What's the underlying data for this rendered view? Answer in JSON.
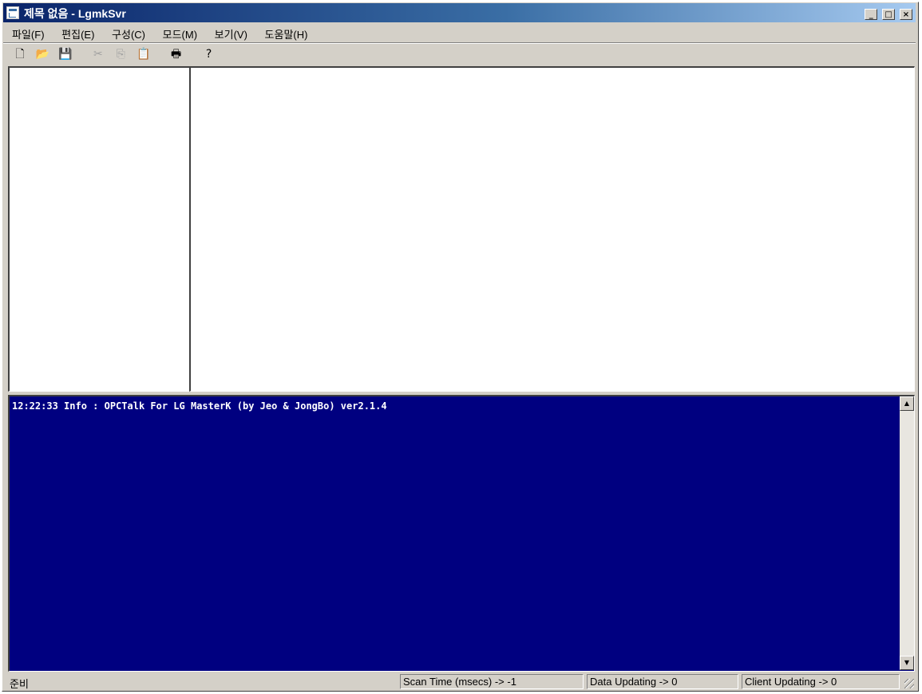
{
  "window": {
    "title": "제목 없음 - LgmkSvr",
    "controls": {
      "minimize": "_",
      "maximize": "□",
      "close": "×"
    }
  },
  "menu": [
    {
      "label": "파일(F)"
    },
    {
      "label": "편집(E)"
    },
    {
      "label": "구성(C)"
    },
    {
      "label": "모드(M)"
    },
    {
      "label": "보기(V)"
    },
    {
      "label": "도움말(H)"
    }
  ],
  "toolbar": {
    "buttons": [
      {
        "name": "new-file-icon",
        "glyph": "🗋",
        "enabled": true
      },
      {
        "name": "open-folder-icon",
        "glyph": "📂",
        "enabled": true
      },
      {
        "name": "save-icon",
        "glyph": "💾",
        "enabled": true
      },
      {
        "name": "cut-icon",
        "glyph": "✂",
        "enabled": false
      },
      {
        "name": "copy-icon",
        "glyph": "⎘",
        "enabled": false
      },
      {
        "name": "paste-icon",
        "glyph": "📋",
        "enabled": false
      },
      {
        "name": "print-icon",
        "glyph": "🖶",
        "enabled": true
      },
      {
        "name": "help-icon",
        "glyph": "?",
        "enabled": true
      }
    ]
  },
  "log": {
    "lines": [
      "12:22:33 Info : OPCTalk For LG MasterK (by Jeo & JongBo) ver2.1.4"
    ],
    "background": "#000080"
  },
  "status": {
    "ready": "준비",
    "scan_time": "Scan Time (msecs) -> -1",
    "data_updating": "Data Updating -> 0",
    "client_updating": "Client Updating -> 0"
  }
}
